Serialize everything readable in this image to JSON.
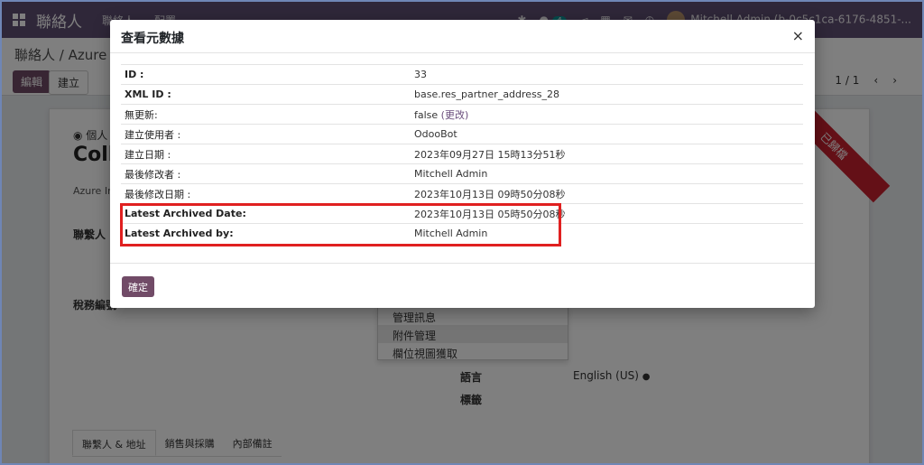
{
  "navbar": {
    "app_title": "聯絡人",
    "menu": [
      "聯絡人",
      "配置"
    ],
    "chat_badge": "4",
    "user": "Mitchell Admin (b-0c5c1ca-6176-4851-..."
  },
  "control": {
    "breadcrumb": "聯絡人 / Azure Int",
    "edit_label": "編輯",
    "create_label": "建立",
    "pager": "1 / 1",
    "prev": "‹",
    "next": "›"
  },
  "sheet": {
    "ribbon": "已歸檔",
    "radio_label": "個人",
    "record_name": "Colle",
    "company": "Azure Inte",
    "contact_label": "聯繫人",
    "tax_label": "稅務編號",
    "language_label": "語言",
    "language_value": "English (US)",
    "tags_label": "標籤"
  },
  "dropdown": {
    "items": [
      "管理訊息",
      "附件管理",
      "欄位視圖獲取"
    ]
  },
  "tabs": [
    "聯繫人 & 地址",
    "銷售與採購",
    "內部備註"
  ],
  "modal": {
    "title": "查看元數據",
    "close": "×",
    "rows": [
      {
        "key": "ID :",
        "value": "33"
      },
      {
        "key": "XML ID :",
        "value": "base.res_partner_address_28"
      },
      {
        "key": "無更新:",
        "value": "false",
        "link": "(更改)"
      },
      {
        "key": "建立使用者 :",
        "value": "OdooBot"
      },
      {
        "key": "建立日期 :",
        "value": "2023年09月27日 15時13分51秒"
      },
      {
        "key": "最後修改者 :",
        "value": "Mitchell Admin"
      },
      {
        "key": "最後修改日期 :",
        "value": "2023年10月13日 09時50分08秒"
      },
      {
        "key": "Latest Archived Date:",
        "value": "2023年10月13日 05時50分08秒"
      },
      {
        "key": "Latest Archived by:",
        "value": "Mitchell Admin"
      }
    ],
    "ok_label": "確定"
  },
  "colors": {
    "navbar": "#5f4e73",
    "primary": "#714b67",
    "highlight": "#e02020",
    "ribbon": "#c8202f"
  }
}
